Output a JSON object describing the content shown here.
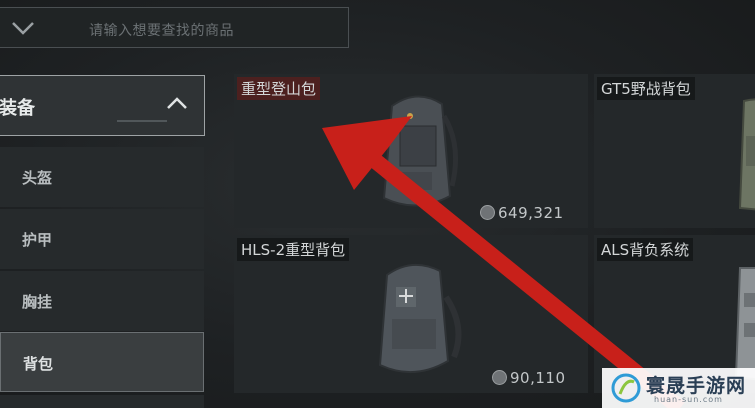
{
  "search": {
    "placeholder": "请输入想要查找的商品"
  },
  "sidebar": {
    "category": "装备",
    "items": [
      {
        "label": "头盔",
        "active": false
      },
      {
        "label": "护甲",
        "active": false
      },
      {
        "label": "胸挂",
        "active": false
      },
      {
        "label": "背包",
        "active": true
      }
    ]
  },
  "products": [
    {
      "name": "重型登山包",
      "price": "649,321",
      "rarity_color": "#5a1e1c"
    },
    {
      "name": "GT5野战背包",
      "price": ""
    },
    {
      "name": "HLS-2重型背包",
      "price": "90,110"
    },
    {
      "name": "ALS背负系统",
      "price": ""
    }
  ],
  "annotation": {
    "arrow_color": "#c8201a"
  },
  "watermark": {
    "brand": "寰晟手游网",
    "domain": "huan-sun.com"
  }
}
